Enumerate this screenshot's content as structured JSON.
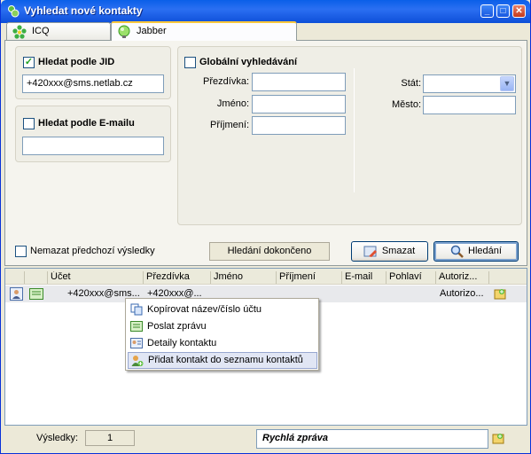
{
  "window": {
    "title": "Vyhledat nové kontakty",
    "min": "_",
    "max": "□",
    "close": "✕"
  },
  "tabs": [
    {
      "label": "ICQ",
      "icon": "icq-flower-icon"
    },
    {
      "label": "Jabber",
      "icon": "jabber-bulb-icon"
    }
  ],
  "jid": {
    "label": "Hledat podle JID",
    "checked": "✓",
    "value": "+420xxx@sms.netlab.cz"
  },
  "email": {
    "label": "Hledat podle E-mailu",
    "value": ""
  },
  "global": {
    "label": "Globální vyhledávání",
    "nick_label": "Přezdívka:",
    "name_label": "Jméno:",
    "surname_label": "Příjmení:",
    "state_label": "Stát:",
    "city_label": "Město:"
  },
  "controls": {
    "keep_results_label": "Nemazat předchozí výsledky",
    "status": "Hledání dokončeno",
    "clear_label": "Smazat",
    "search_label": "Hledání"
  },
  "columns": [
    "Účet",
    "Přezdívka",
    "Jméno",
    "Příjmení",
    "E-mail",
    "Pohlaví",
    "Autoriz..."
  ],
  "rows": [
    {
      "account": "+420xxx@sms...",
      "nick": "+420xxx@...",
      "auth": "Autorizo..."
    }
  ],
  "context_menu": [
    "Kopírovat název/číslo účtu",
    "Poslat zprávu",
    "Detaily kontaktu",
    "Přidat kontakt do seznamu kontaktů"
  ],
  "footer": {
    "results_label": "Výsledky:",
    "results_count": "1",
    "quick_message": "Rychlá zpráva"
  },
  "colors": {
    "title_bar": "#0a5fe8",
    "tab_active_top": "#ffc83c",
    "menu_highlight": "#e1e6f4"
  }
}
